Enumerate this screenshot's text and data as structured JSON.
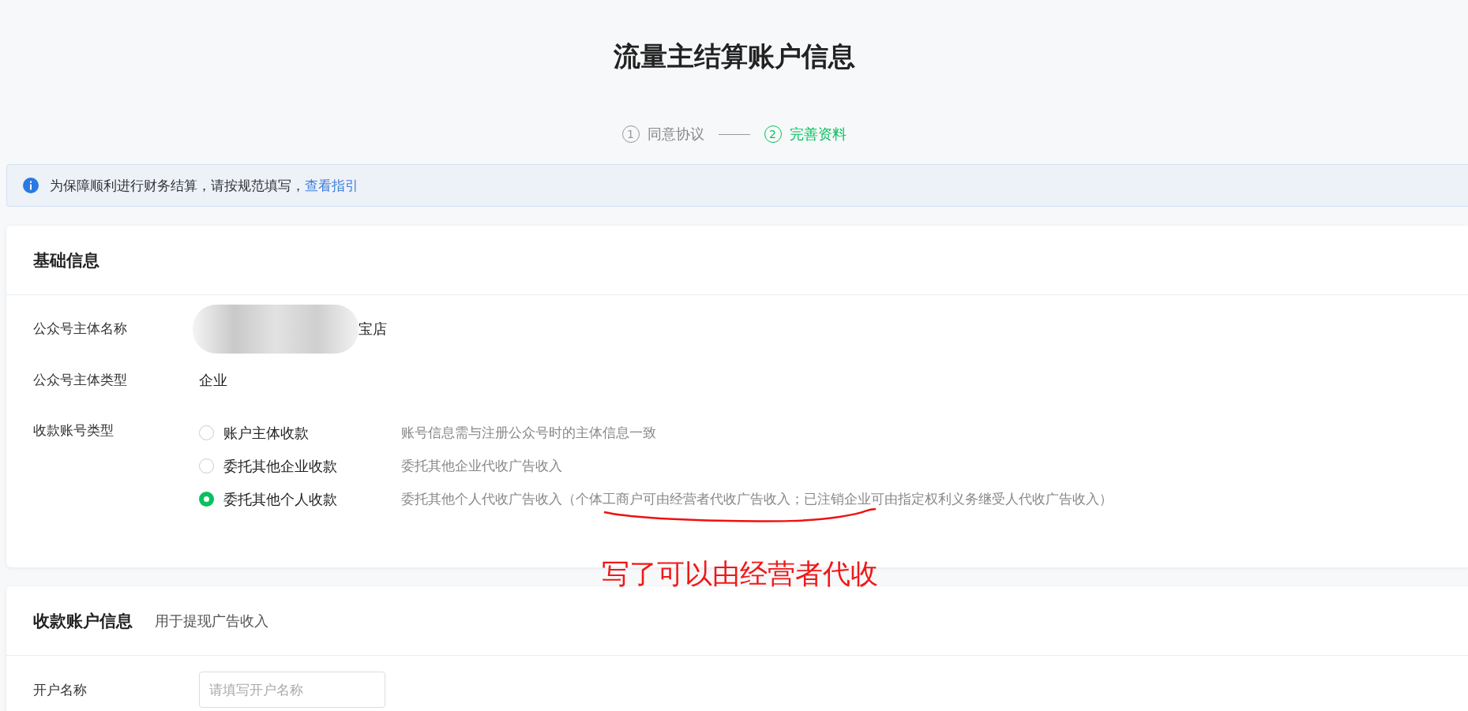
{
  "page": {
    "title": "流量主结算账户信息"
  },
  "steps": [
    {
      "number": "1",
      "label": "同意协议",
      "active": false
    },
    {
      "number": "2",
      "label": "完善资料",
      "active": true
    }
  ],
  "notice": {
    "text": "为保障顺利进行财务结算，请按规范填写，",
    "link": "查看指引"
  },
  "basic_info": {
    "title": "基础信息",
    "fields": [
      {
        "label": "公众号主体名称",
        "value": "宝店",
        "redacted": true
      },
      {
        "label": "公众号主体类型",
        "value": "企业",
        "redacted": false
      }
    ],
    "account_type": {
      "label": "收款账号类型",
      "options": [
        {
          "label": "账户主体收款",
          "description": "账号信息需与注册公众号时的主体信息一致",
          "selected": false
        },
        {
          "label": "委托其他企业收款",
          "description": "委托其他企业代收广告收入",
          "selected": false
        },
        {
          "label": "委托其他个人收款",
          "description": "委托其他个人代收广告收入（个体工商户可由经营者代收广告收入；已注销企业可由指定权利义务继受人代收广告收入）",
          "selected": true
        }
      ]
    }
  },
  "annotation": {
    "text": "写了可以由经营者代收"
  },
  "account_info": {
    "title": "收款账户信息",
    "subtitle": "用于提现广告收入",
    "fields": [
      {
        "label": "开户名称",
        "placeholder": "请填写开户名称"
      }
    ]
  }
}
